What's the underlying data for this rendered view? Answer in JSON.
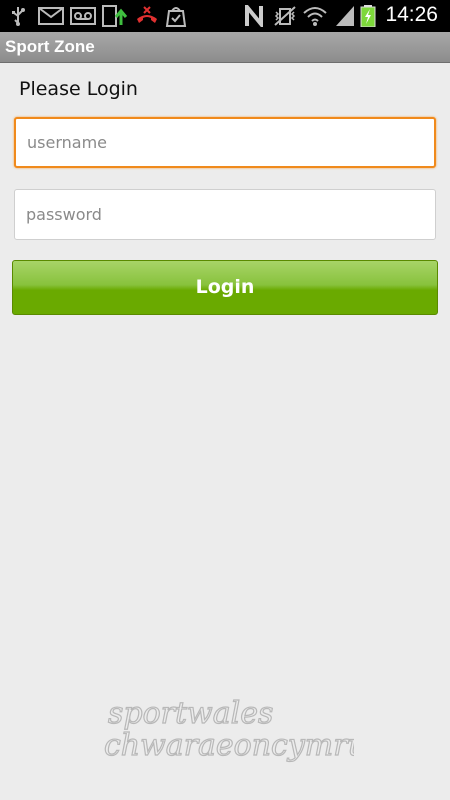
{
  "status_bar": {
    "time": "14:26",
    "icons": [
      "usb-icon",
      "email-icon",
      "voicemail-icon",
      "screenshot-upload-icon",
      "missed-call-icon",
      "task-check-icon",
      "nfc-icon",
      "vibrate-icon",
      "wifi-icon",
      "signal-icon",
      "battery-charging-icon"
    ]
  },
  "app": {
    "title": "Sport Zone"
  },
  "login": {
    "heading": "Please Login",
    "username_placeholder": "username",
    "password_placeholder": "password",
    "button_label": "Login"
  },
  "logo": {
    "line1": "sportwales",
    "line2": "chwaraeoncymru"
  }
}
